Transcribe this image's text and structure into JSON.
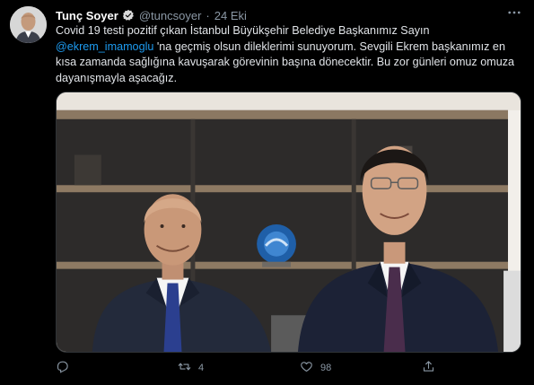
{
  "user": {
    "display_name": "Tunç Soyer",
    "handle": "@tuncsoyer",
    "separator": "·",
    "time": "24 Eki",
    "verified": true
  },
  "tweet": {
    "text_part1": "Covid 19 testi pozitif çıkan İstanbul Büyükşehir Belediye Başkanımız Sayın ",
    "mention": "@ekrem_imamoglu",
    "text_part2": " 'na geçmiş olsun dileklerimi sunuyorum. Sevgili Ekrem başkanımız en kısa zamanda sağlığına kavuşarak görevinin başına dönecektir. Bu zor günleri omuz omuza dayanışmayla aşacağız."
  },
  "actions": {
    "reply_count": "",
    "retweet_count": "4",
    "like_count": "98",
    "share_count": ""
  },
  "icons": {
    "verified": "verified-badge-icon",
    "more": "more-horizontal-icon",
    "reply": "reply-icon",
    "retweet": "retweet-icon",
    "like": "heart-icon",
    "share": "share-icon"
  },
  "colors": {
    "background": "#000000",
    "text": "#e1e4e8",
    "secondary": "#8b98a5",
    "accent": "#1d9bf0"
  }
}
